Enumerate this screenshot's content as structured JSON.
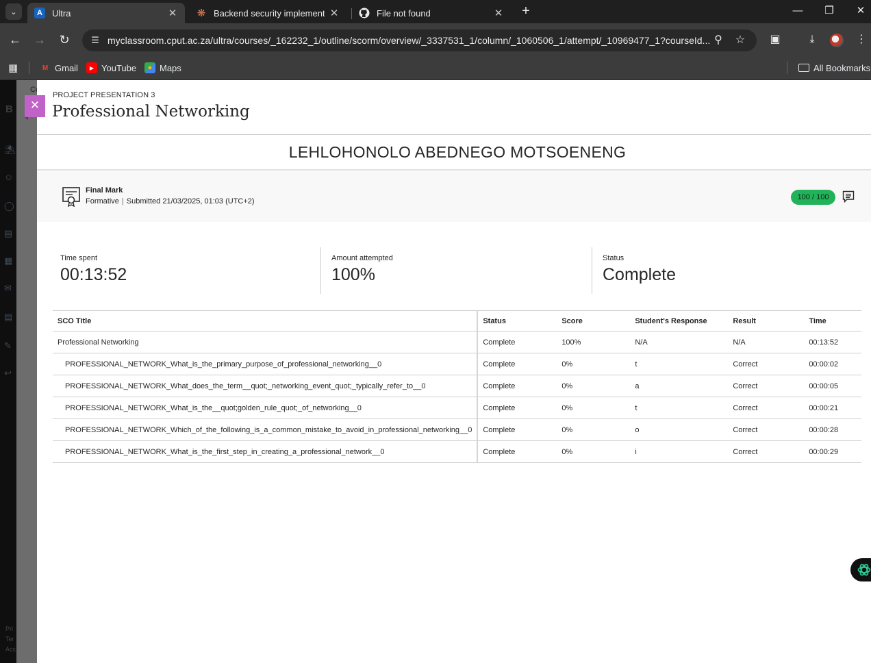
{
  "browser": {
    "tabs": [
      {
        "title": "Ultra",
        "favicon": "blackboard-a-icon",
        "active": true
      },
      {
        "title": "Backend security implementatio",
        "favicon": "claude-icon",
        "active": false
      },
      {
        "title": "File not found",
        "favicon": "github-icon",
        "active": false
      }
    ],
    "url": "myclassroom.cput.ac.za/ultra/courses/_162232_1/outline/scorm/overview/_3337531_1/column/_1060506_1/attempt/_10969477_1?courseId...",
    "bookmarks": [
      "Gmail",
      "YouTube",
      "Maps"
    ],
    "all_bookmarks": "All Bookmarks"
  },
  "underlay": {
    "peek_text": "Co",
    "logo_text": "B",
    "footer_lines": [
      "Pri",
      "Ter",
      "Acc"
    ]
  },
  "panel": {
    "eyebrow": "PROJECT PRESENTATION 3",
    "title": "Professional Networking",
    "student_name": "LEHLOHONOLO ABEDNEGO MOTSOENENG",
    "grade": {
      "label": "Final Mark",
      "type": "Formative",
      "submitted": "Submitted 21/03/2025, 01:03 (UTC+2)",
      "score": "100 / 100"
    },
    "stats": [
      {
        "label": "Time spent",
        "value": "00:13:52"
      },
      {
        "label": "Amount attempted",
        "value": "100%"
      },
      {
        "label": "Status",
        "value": "Complete"
      }
    ],
    "table": {
      "headers": [
        "SCO Title",
        "Status",
        "Score",
        "Student's Response",
        "Result",
        "Time"
      ],
      "rows": [
        [
          "Professional Networking",
          "Complete",
          "100%",
          "N/A",
          "N/A",
          "00:13:52"
        ],
        [
          "PROFESSIONAL_NETWORK_What_is_the_primary_purpose_of_professional_networking__0",
          "Complete",
          "0%",
          "t",
          "Correct",
          "00:00:02"
        ],
        [
          "PROFESSIONAL_NETWORK_What_does_the_term__quot;_networking_event_quot;_typically_refer_to__0",
          "Complete",
          "0%",
          "a",
          "Correct",
          "00:00:05"
        ],
        [
          "PROFESSIONAL_NETWORK_What_is_the__quot;golden_rule_quot;_of_networking__0",
          "Complete",
          "0%",
          "t",
          "Correct",
          "00:00:21"
        ],
        [
          "PROFESSIONAL_NETWORK_Which_of_the_following_is_a_common_mistake_to_avoid_in_professional_networking__0",
          "Complete",
          "0%",
          "o",
          "Correct",
          "00:00:28"
        ],
        [
          "PROFESSIONAL_NETWORK_What_is_the_first_step_in_creating_a_professional_network__0",
          "Complete",
          "0%",
          "i",
          "Correct",
          "00:00:29"
        ]
      ]
    }
  },
  "colors": {
    "score_pill": "#21b25a",
    "close_button": "#c062c8",
    "chrome_dark": "#1f1f1f",
    "chrome_toolbar": "#3c3c3c"
  }
}
